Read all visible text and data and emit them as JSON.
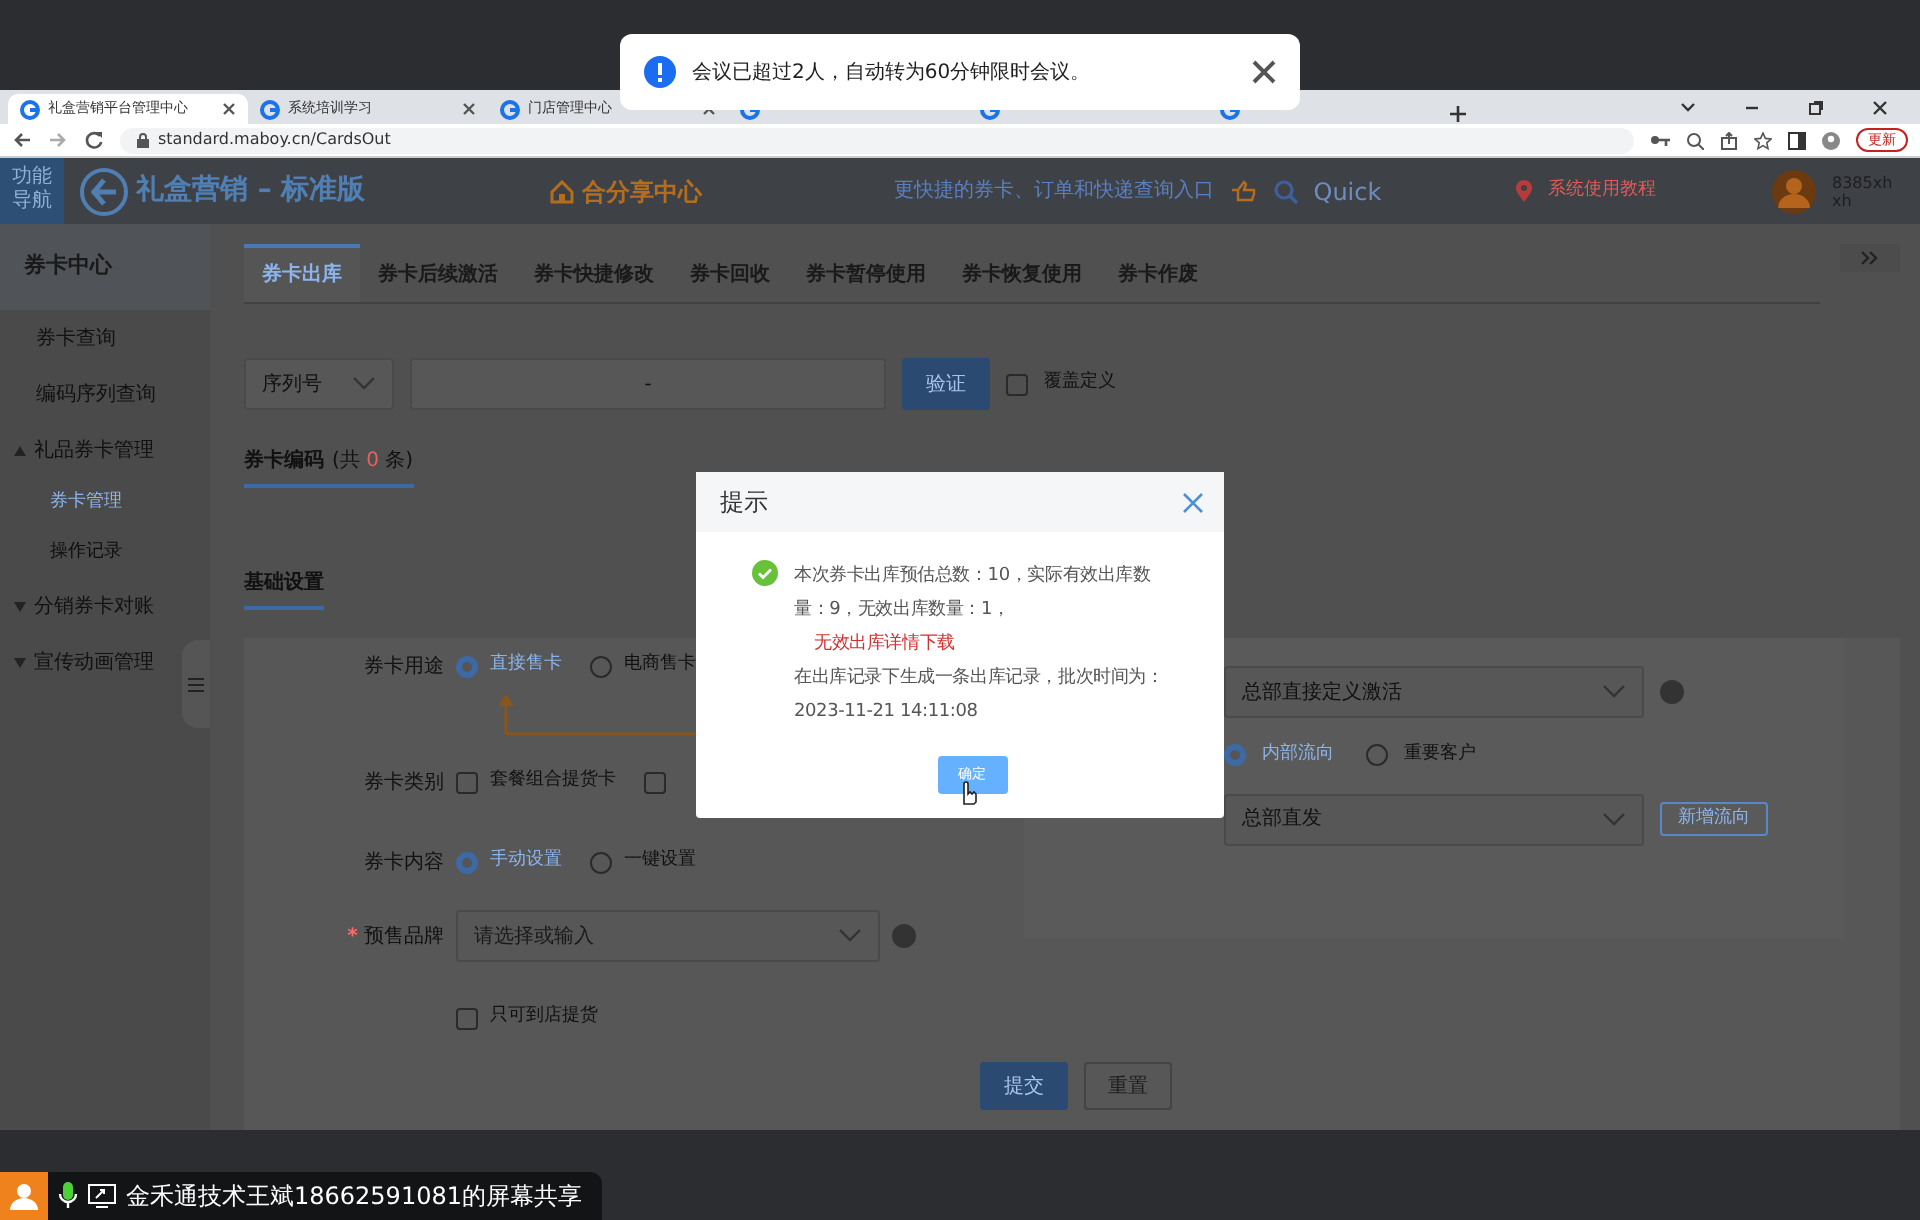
{
  "meeting_toast": {
    "text": "会议已超过2人，自动转为60分钟限时会议。"
  },
  "browser": {
    "tabs": [
      {
        "title": "礼盒营销平台管理中心",
        "selected": true
      },
      {
        "title": "系统培训学习",
        "selected": false
      },
      {
        "title": "门店管理中心",
        "selected": false
      }
    ],
    "url": "standard.maboy.cn/CardsOut",
    "update_button": "更新"
  },
  "header": {
    "nav_toggle": "功能导航",
    "brand": "礼盒营销 – 标准版",
    "share_center": "合分享中心",
    "quick_entry": "更快捷的券卡、订单和快递查询入口",
    "quick_search": "Quick",
    "tutorial": "系统使用教程",
    "user": "8385xh xh"
  },
  "sidebar": {
    "title": "券卡中心",
    "items": [
      {
        "label": "券卡查询",
        "kind": "link",
        "selected": false
      },
      {
        "label": "编码序列查询",
        "kind": "link",
        "selected": false
      },
      {
        "label": "礼品券卡管理",
        "kind": "group",
        "expanded": true,
        "children": [
          {
            "label": "券卡管理",
            "selected": true
          },
          {
            "label": "操作记录",
            "selected": false
          }
        ]
      },
      {
        "label": "分销券卡对账",
        "kind": "group",
        "expanded": false
      },
      {
        "label": "宣传动画管理",
        "kind": "group",
        "expanded": false
      }
    ]
  },
  "tabs": [
    {
      "label": "券卡出库",
      "selected": true
    },
    {
      "label": "券卡后续激活",
      "selected": false
    },
    {
      "label": "券卡快捷修改",
      "selected": false
    },
    {
      "label": "券卡回收",
      "selected": false
    },
    {
      "label": "券卡暂停使用",
      "selected": false
    },
    {
      "label": "券卡恢复使用",
      "selected": false
    },
    {
      "label": "券卡作废",
      "selected": false
    }
  ],
  "search_row": {
    "mode": "序列号",
    "range_separator": "-",
    "verify_button": "验证",
    "override": {
      "label": "覆盖定义",
      "checked": false
    }
  },
  "code_section": {
    "title": "券卡编码",
    "count_prefix": "(共 ",
    "count": "0",
    "count_suffix": " 条)"
  },
  "basic_section": {
    "title": "基础设置"
  },
  "form": {
    "rows": [
      {
        "kind": "radio",
        "label": "券卡用途",
        "options": [
          {
            "label": "直接售卡",
            "selected": true
          },
          {
            "label": "电商售卡",
            "selected": false
          }
        ]
      },
      {
        "kind": "checkbox",
        "label": "券卡类别",
        "options": [
          {
            "label": "套餐组合提货卡",
            "checked": false
          },
          {
            "checked": false
          }
        ]
      },
      {
        "kind": "radio",
        "label": "券卡内容",
        "options": [
          {
            "label": "手动设置",
            "selected": true
          },
          {
            "label": "一键设置",
            "selected": false
          }
        ]
      },
      {
        "kind": "select",
        "label": "预售品牌",
        "required_mark": "*",
        "placeholder": "请选择或输入"
      },
      {
        "kind": "checkbox",
        "options": [
          {
            "label": "只可到店提货",
            "checked": false
          }
        ]
      }
    ]
  },
  "side_panel": {
    "activation_select": "总部直接定义激活",
    "flow_options": [
      {
        "label": "内部流向",
        "selected": true
      },
      {
        "label": "重要客户",
        "selected": false
      }
    ],
    "flow_select": "总部直发",
    "add_flow_button": "新增流向"
  },
  "actions": {
    "submit": "提交",
    "reset": "重置"
  },
  "dialog": {
    "title": "提示",
    "message": "本次券卡出库预估总数：10，实际有效出库数量：9，无效出库数量：1，",
    "link": "无效出库详情下载",
    "note": "在出库记录下生成一条出库记录，批次时间为：2023-11-21 14:11:08",
    "ok_button": "确定"
  },
  "share_bar": {
    "text": "金禾通技术王斌18662591081的屏幕共享"
  }
}
